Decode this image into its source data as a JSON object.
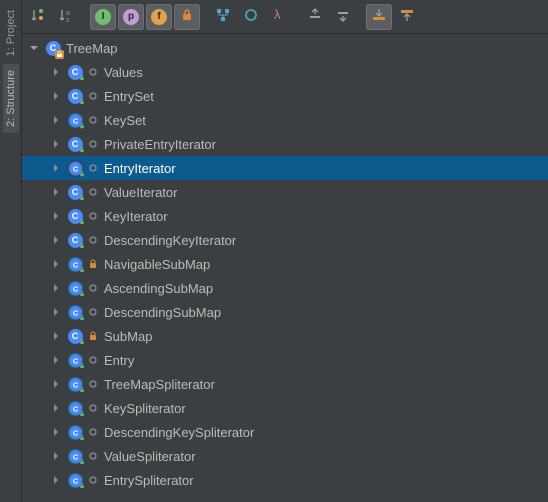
{
  "sidebar": {
    "tabs": [
      {
        "label": "1: Project",
        "id": "project"
      },
      {
        "label": "2: Structure",
        "id": "structure"
      }
    ],
    "active": 1
  },
  "toolbar": {
    "items": [
      {
        "id": "sort-visibility",
        "type": "icon",
        "toggled": false
      },
      {
        "id": "sort-alpha",
        "type": "icon",
        "toggled": false
      },
      {
        "id": "sep"
      },
      {
        "id": "show-interfaces",
        "type": "letter",
        "letter": "I",
        "color": "#6fbf73",
        "toggled": true
      },
      {
        "id": "show-properties",
        "type": "letter",
        "letter": "p",
        "color": "#c39bd8",
        "toggled": true
      },
      {
        "id": "show-fields",
        "type": "letter",
        "letter": "f",
        "color": "#e0a24b",
        "toggled": true
      },
      {
        "id": "show-locks",
        "type": "icon",
        "toggled": true
      },
      {
        "id": "sep"
      },
      {
        "id": "show-inherited",
        "type": "icon",
        "toggled": false
      },
      {
        "id": "show-anonymous",
        "type": "icon",
        "toggled": false
      },
      {
        "id": "show-lambda",
        "type": "icon",
        "toggled": false
      },
      {
        "id": "sep"
      },
      {
        "id": "expand-all",
        "type": "icon",
        "toggled": false
      },
      {
        "id": "collapse-all",
        "type": "icon",
        "toggled": false
      },
      {
        "id": "sep"
      },
      {
        "id": "autoscroll-source",
        "type": "icon",
        "toggled": true
      },
      {
        "id": "autoscroll-from",
        "type": "icon",
        "toggled": false
      }
    ]
  },
  "tree": {
    "root": {
      "label": "TreeMap",
      "icon": "class",
      "lock": true,
      "expanded": true
    },
    "children": [
      {
        "label": "Values",
        "icon": "inner",
        "vis": "default"
      },
      {
        "label": "EntrySet",
        "icon": "inner",
        "vis": "default"
      },
      {
        "label": "KeySet",
        "icon": "static",
        "vis": "default"
      },
      {
        "label": "PrivateEntryIterator",
        "icon": "inner",
        "vis": "default"
      },
      {
        "label": "EntryIterator",
        "icon": "static",
        "vis": "default",
        "selected": true
      },
      {
        "label": "ValueIterator",
        "icon": "inner",
        "vis": "default"
      },
      {
        "label": "KeyIterator",
        "icon": "inner",
        "vis": "default"
      },
      {
        "label": "DescendingKeyIterator",
        "icon": "inner",
        "vis": "default"
      },
      {
        "label": "NavigableSubMap",
        "icon": "static",
        "vis": "private"
      },
      {
        "label": "AscendingSubMap",
        "icon": "static",
        "vis": "default"
      },
      {
        "label": "DescendingSubMap",
        "icon": "static",
        "vis": "default"
      },
      {
        "label": "SubMap",
        "icon": "inner",
        "vis": "private"
      },
      {
        "label": "Entry",
        "icon": "static",
        "vis": "default"
      },
      {
        "label": "TreeMapSpliterator",
        "icon": "static",
        "vis": "default"
      },
      {
        "label": "KeySpliterator",
        "icon": "static",
        "vis": "default"
      },
      {
        "label": "DescendingKeySpliterator",
        "icon": "static",
        "vis": "default"
      },
      {
        "label": "ValueSpliterator",
        "icon": "static",
        "vis": "default"
      },
      {
        "label": "EntrySpliterator",
        "icon": "static",
        "vis": "default"
      }
    ]
  }
}
